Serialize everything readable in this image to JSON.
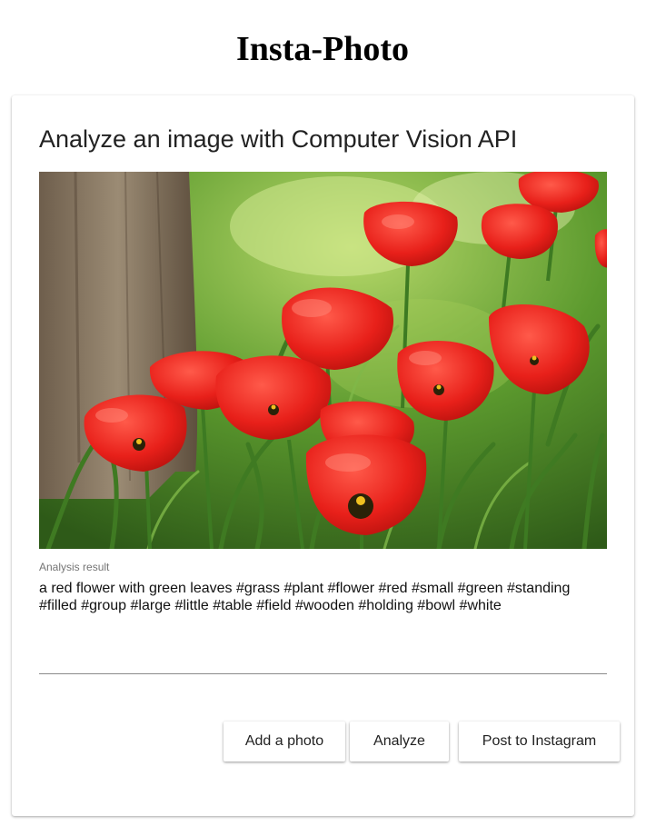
{
  "app": {
    "title": "Insta-Photo"
  },
  "card": {
    "title": "Analyze an image with Computer Vision API",
    "photo_alt": "red tulips",
    "result_label": "Analysis result",
    "result_text": "a red flower with green leaves #grass #plant #flower #red #small #green #standing #filled #group #large #little #table #field #wooden #holding #bowl #white"
  },
  "buttons": {
    "add_photo": "Add a photo",
    "analyze": "Analyze",
    "post_instagram": "Post to Instagram"
  },
  "colors": {
    "tulip_red": "#e8201a",
    "foliage_green": "#4f8a2a",
    "trunk_brown": "#8a7a66"
  }
}
